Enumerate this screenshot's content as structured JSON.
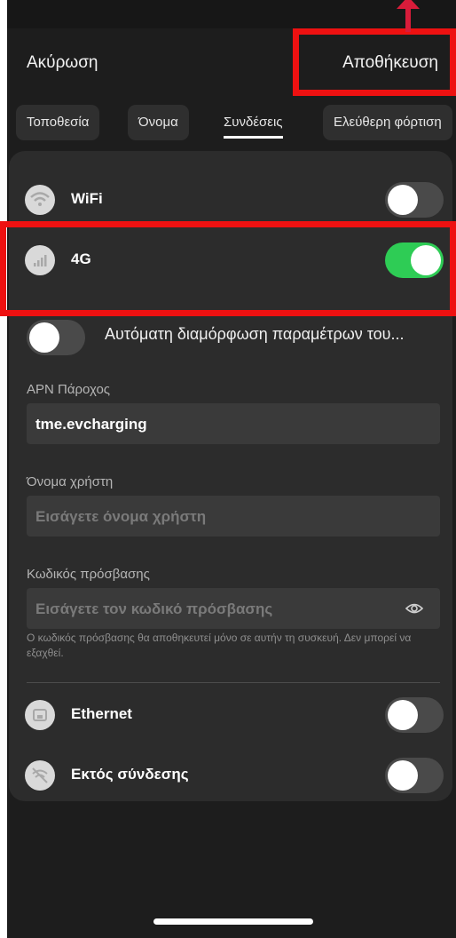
{
  "header": {
    "cancel_label": "Ακύρωση",
    "save_label": "Αποθήκευση"
  },
  "tabs": [
    {
      "label": "Τοποθεσία",
      "active": false
    },
    {
      "label": "Όνομα",
      "active": false
    },
    {
      "label": "Συνδέσεις",
      "active": true
    },
    {
      "label": "Ελεύθερη φόρτιση",
      "active": false
    }
  ],
  "connections": {
    "wifi": {
      "label": "WiFi",
      "enabled": false
    },
    "cellular": {
      "label": "4G",
      "enabled": true
    },
    "auto_config": {
      "label": "Αυτόματη διαμόρφωση παραμέτρων του...",
      "enabled": false
    },
    "apn": {
      "label": "APN Πάροχος",
      "value": "tme.evcharging"
    },
    "username": {
      "label": "Όνομα χρήστη",
      "placeholder": "Εισάγετε όνομα χρήστη"
    },
    "password": {
      "label": "Κωδικός πρόσβασης",
      "placeholder": "Εισάγετε τον κωδικό πρόσβασης",
      "note": "Ο κωδικός πρόσβασης θα αποθηκευτεί μόνο σε αυτήν τη συσκευή. Δεν μπορεί να εξαχθεί."
    },
    "ethernet": {
      "label": "Ethernet",
      "enabled": false
    },
    "offline": {
      "label": "Εκτός σύνδεσης",
      "enabled": false
    }
  },
  "colors": {
    "background": "#1d1d1d",
    "card": "#2c2c2c",
    "toggle_on": "#2ecc55",
    "highlight": "#ee1111"
  },
  "icons": {
    "wifi": "wifi-icon",
    "cellular": "signal-icon",
    "ethernet": "ethernet-icon",
    "offline": "wifi-off-icon",
    "password_visibility": "eye-icon"
  }
}
